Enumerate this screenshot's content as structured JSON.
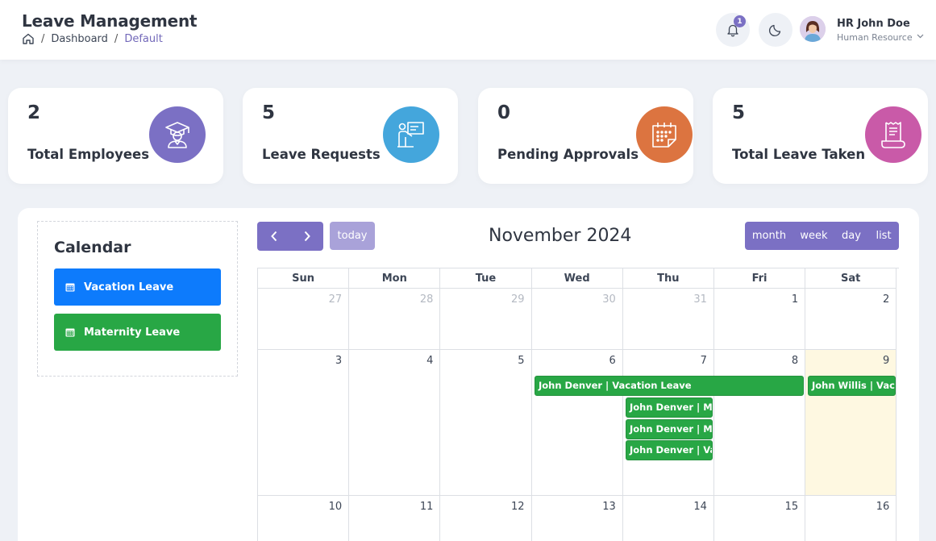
{
  "header": {
    "title": "Leave Management",
    "breadcrumb": {
      "dashboard": "Dashboard",
      "current": "Default",
      "separator": "/"
    },
    "notification_count": "1",
    "user": {
      "name": "HR John Doe",
      "role": "Human Resource"
    }
  },
  "stats": [
    {
      "value": "2",
      "label": "Total Employees",
      "color": "#7b70c4",
      "icon": "graduate-icon"
    },
    {
      "value": "5",
      "label": "Leave Requests",
      "color": "#44a6dc",
      "icon": "presentation-icon"
    },
    {
      "value": "0",
      "label": "Pending Approvals",
      "color": "#dc7440",
      "icon": "calendar-icon"
    },
    {
      "value": "5",
      "label": "Total Leave Taken",
      "color": "#c95aa8",
      "icon": "receipt-icon"
    }
  ],
  "sidebar": {
    "title": "Calendar",
    "legend": [
      {
        "label": "Vacation Leave",
        "color": "#0d7bfc"
      },
      {
        "label": "Maternity Leave",
        "color": "#28a745"
      }
    ]
  },
  "calendar": {
    "title": "November 2024",
    "today_label": "today",
    "views": [
      "month",
      "week",
      "day",
      "list"
    ],
    "days_of_week": [
      "Sun",
      "Mon",
      "Tue",
      "Wed",
      "Thu",
      "Fri",
      "Sat"
    ],
    "weeks": [
      [
        "27",
        "28",
        "29",
        "30",
        "31",
        "1",
        "2"
      ],
      [
        "3",
        "4",
        "5",
        "6",
        "7",
        "8",
        "9"
      ],
      [
        "10",
        "11",
        "12",
        "13",
        "14",
        "15",
        "16"
      ]
    ],
    "today": "9",
    "events": [
      {
        "text": "John Denver | Vacation Leave",
        "color": "#28a745"
      },
      {
        "text": "John Denver | Maternity Leave",
        "color": "#28a745"
      },
      {
        "text": "John Denver | Maternity Leave",
        "color": "#28a745"
      },
      {
        "text": "John Denver | Vacation Leave",
        "color": "#28a745"
      },
      {
        "text": "John Willis | Vacation Leave",
        "color": "#28a745"
      }
    ]
  }
}
